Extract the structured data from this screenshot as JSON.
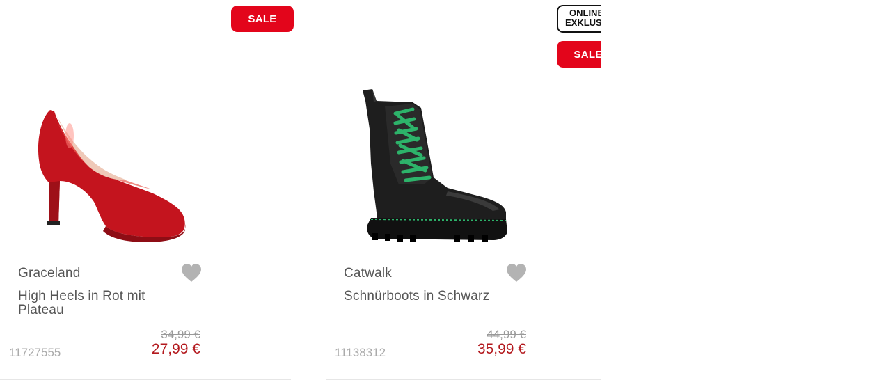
{
  "products": [
    {
      "badges": {
        "sale": "SALE"
      },
      "brand": "Graceland",
      "name": "High Heels in Rot mit Plateau",
      "old_price": "34,99 €",
      "price": "27,99 €",
      "article_number": "11727555",
      "image": "red-high-heel-pump",
      "favorite_icon": "heart-icon",
      "colors": {
        "sale_badge": "#e3051b",
        "price": "#b3191e"
      }
    },
    {
      "badges": {
        "online": "ONLINE EXKLUSIV",
        "online_line1": "ONLINE",
        "online_line2": "EXKLUSIV",
        "sale": "SALE"
      },
      "brand": "Catwalk",
      "name": "Schnürboots in Schwarz",
      "old_price": "44,99 €",
      "price": "35,99 €",
      "article_number": "11138312",
      "image": "black-lace-up-boot-green-laces",
      "favorite_icon": "heart-icon",
      "colors": {
        "sale_badge": "#e3051b",
        "price": "#b3191e"
      }
    }
  ]
}
